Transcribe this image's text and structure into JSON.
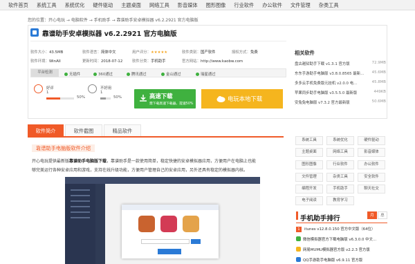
{
  "topnav": [
    "软件首页",
    "系统工具",
    "系统优化",
    "硬件驱动",
    "主题桌面",
    "网络工具",
    "影音媒体",
    "图形图像",
    "行业软件",
    "办公软件",
    "文件管理",
    "杂类工具"
  ],
  "breadcrumb": "您的位置：开心电玩 → 电脑软件 → 手机助手 → 靠谱助手安卓模拟器 v6.2.2921 官方电脑版",
  "title": "靠谱助手安卓模拟器 v6.2.2921 官方电脑版",
  "meta": {
    "size_label": "软件大小：",
    "size": "43.5MB",
    "lang_label": "软件语言：",
    "lang": "简体中文",
    "rating_label": "用户评分：",
    "rating_stars": "★★★★★",
    "cat_label": "软件类别：",
    "cat": "国产软件",
    "auth_label": "授权方式：",
    "auth": "免费",
    "env_label": "软件环境：",
    "env": "WinAll",
    "date_label": "更新时间：",
    "date": "2018-07-12",
    "cls_label": "软件分类：",
    "cls": "手机助手",
    "home_label": "官方网站：",
    "home": "http://www.kaobw.com"
  },
  "checks": {
    "platform": "平台检测",
    "items": [
      {
        "label": "无插件",
        "color": "#3fb13f"
      },
      {
        "label": "360通过",
        "color": "#3fb13f"
      },
      {
        "label": "腾讯通过",
        "color": "#3fb13f"
      },
      {
        "label": "金山通过",
        "color": "#3fb13f"
      },
      {
        "label": "瑞星通过",
        "color": "#3fb13f"
      }
    ]
  },
  "votes": {
    "good_label": "好评",
    "good_count": "1",
    "good_pct": "50%",
    "good_value": 0.5,
    "bad_label": "不好用",
    "bad_count": "1",
    "bad_pct": "50%",
    "bad_value": 0.5
  },
  "buttons": {
    "fast_dl": "高速下载",
    "fast_dl_sub": "需下载高速下载器，提速50%",
    "local_dl": "电玩本地下载"
  },
  "related": {
    "title": "相关软件",
    "items": [
      {
        "name": "盘古越狱助手下载 v1.3.1 官方版",
        "size": "72.9MB"
      },
      {
        "name": "东东手游助手电脑版 v3.8.0.8565 最新...",
        "size": "45.6MB"
      },
      {
        "name": "多多云手机免费版元挂机 v2.0.0 电...",
        "size": "45.8MB"
      },
      {
        "name": "苹果同步助手电脑版 v3.5.5.0 最新版",
        "size": "449KB"
      },
      {
        "name": "安兔兔电脑版 v7.3.2 官方最新版",
        "size": "50.6MB"
      }
    ]
  },
  "tabs": [
    "软件简介",
    "软件截图",
    "精品软件"
  ],
  "section_title": "靠谱助手电脑版软件介绍",
  "paragraph": {
    "line1_pre": "开心电玩提供最新版",
    "line1_bold": "靠谱助手电脑版下载",
    "line1_post": "，靠谱助手是一款使用简单，稳定快捷的安卓模拟器应用，方便用户在电脑上也能",
    "line2": "够完美运行各种安卓应用和游戏，支持在线升级功能，方便用户管理自己的安卓应用，另外还具有稳定的模拟器内核。"
  },
  "categories": [
    "系统工具",
    "系统优化",
    "硬件驱动",
    "主题桌面",
    "网络工具",
    "影音媒体",
    "图形图像",
    "行业软件",
    "办公软件",
    "文件管理",
    "杂类工具",
    "安全软件",
    "编程开发",
    "手机助手",
    "聊天社交",
    "电子阅读",
    "教育学习"
  ],
  "ranking": {
    "title": "手机助手排行",
    "tab_month": "月",
    "tab_week": "总",
    "items": [
      {
        "rank": "1",
        "name": "itunes v12.8.0.150 官方中文版（64位）"
      },
      {
        "rank": "2",
        "name": "微信模拟器官方下载电脑版 v6.3.0.0 中文..."
      },
      {
        "rank": "3",
        "name": "网易MUMU模拟器官方版 v2.2.3 官方版"
      },
      {
        "rank": "4",
        "name": "QQ手游助手电脑版 v6.9.11 官方版"
      }
    ]
  }
}
